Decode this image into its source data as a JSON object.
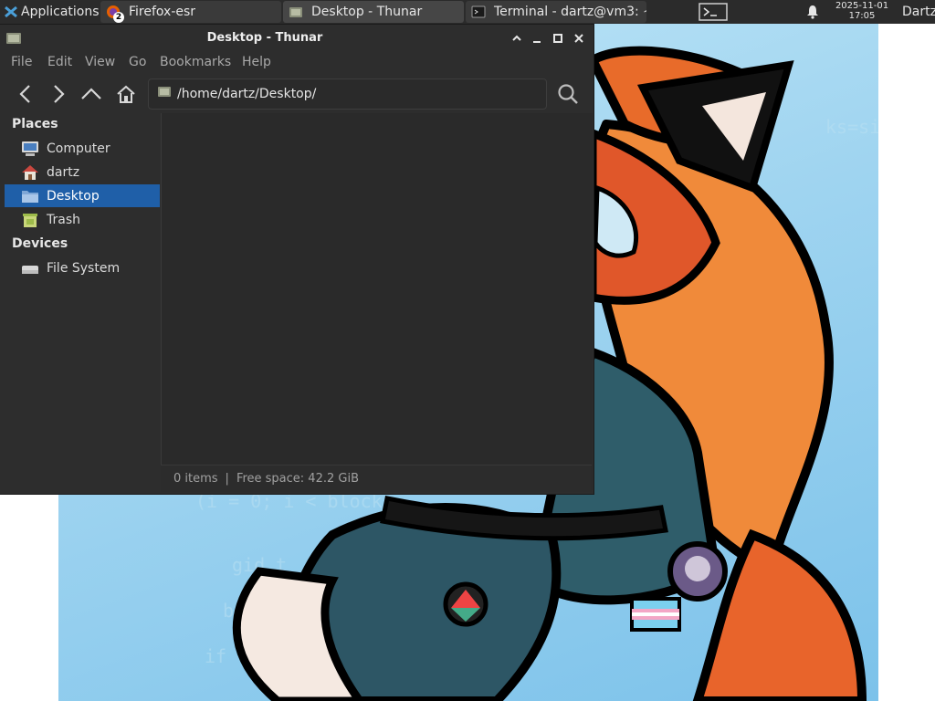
{
  "panel": {
    "applications_label": "Applications",
    "applications_separator": "☰",
    "tasks": [
      {
        "label": "Firefox-esr",
        "badge": "2",
        "icon": "firefox-icon"
      },
      {
        "label": "Desktop - Thunar",
        "icon": "thunar-folder-icon"
      },
      {
        "label": "Terminal - dartz@vm3: ~",
        "icon": "terminal-icon"
      }
    ],
    "clock_date": "2025-11-01",
    "clock_time": "17:05",
    "user": "Dartz"
  },
  "window": {
    "title": "Desktop - Thunar",
    "menu": [
      "File",
      "Edit",
      "View",
      "Go",
      "Bookmarks",
      "Help"
    ],
    "location": "/home/dartz/Desktop/",
    "sidebar": {
      "places_header": "Places",
      "places": [
        {
          "label": "Computer",
          "icon": "computer-icon"
        },
        {
          "label": "dartz",
          "icon": "home-icon"
        },
        {
          "label": "Desktop",
          "icon": "desktop-folder-icon",
          "selected": true
        },
        {
          "label": "Trash",
          "icon": "trash-icon"
        }
      ],
      "devices_header": "Devices",
      "devices": [
        {
          "label": "File System",
          "icon": "drive-icon"
        }
      ]
    },
    "status": {
      "items": "0 items",
      "separator": "|",
      "free_space": "Free space: 42.2 GiB"
    }
  },
  "colors": {
    "panel_bg": "#2b2b2b",
    "window_bg": "#2d2d2d",
    "selection": "#1f5fa8",
    "wallpaper_sky": "#9fd4f0"
  }
}
